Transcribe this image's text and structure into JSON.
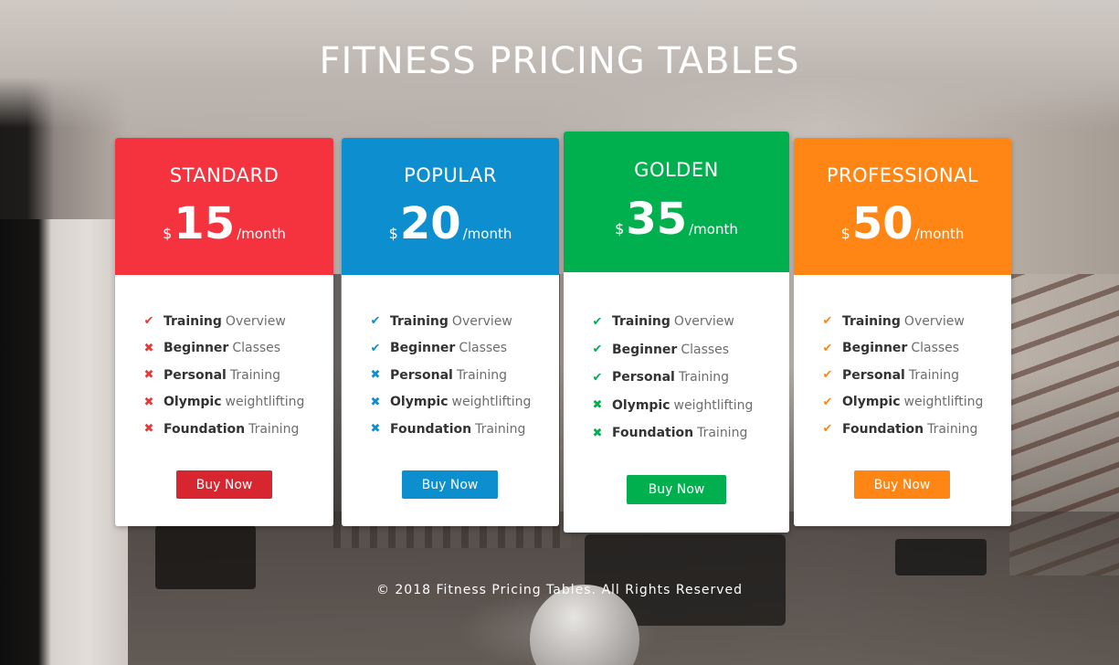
{
  "page": {
    "title": "FITNESS PRICING TABLES",
    "footer": "© 2018 Fitness Pricing Tables. All Rights Reserved"
  },
  "colors": {
    "standard": "#f5333f",
    "popular": "#0d8ece",
    "golden": "#00b04f",
    "professional": "#ff8514",
    "standard_button": "#d7262f",
    "cross": "#e53935"
  },
  "plans": [
    {
      "name": "STANDARD",
      "currency": "$",
      "amount": "15",
      "period": "/month",
      "button": "Buy Now",
      "features": [
        {
          "strong": "Training",
          "light": "Overview",
          "icon": "check-icon"
        },
        {
          "strong": "Beginner",
          "light": "Classes",
          "icon": "cross-icon"
        },
        {
          "strong": "Personal",
          "light": "Training",
          "icon": "cross-icon"
        },
        {
          "strong": "Olympic",
          "light": "weightlifting",
          "icon": "cross-icon"
        },
        {
          "strong": "Foundation",
          "light": "Training",
          "icon": "cross-icon"
        }
      ]
    },
    {
      "name": "POPULAR",
      "currency": "$",
      "amount": "20",
      "period": "/month",
      "button": "Buy Now",
      "features": [
        {
          "strong": "Training",
          "light": "Overview",
          "icon": "check-icon"
        },
        {
          "strong": "Beginner",
          "light": "Classes",
          "icon": "check-icon"
        },
        {
          "strong": "Personal",
          "light": "Training",
          "icon": "cross-icon"
        },
        {
          "strong": "Olympic",
          "light": "weightlifting",
          "icon": "cross-icon"
        },
        {
          "strong": "Foundation",
          "light": "Training",
          "icon": "cross-icon"
        }
      ]
    },
    {
      "name": "GOLDEN",
      "currency": "$",
      "amount": "35",
      "period": "/month",
      "button": "Buy Now",
      "features": [
        {
          "strong": "Training",
          "light": "Overview",
          "icon": "check-icon"
        },
        {
          "strong": "Beginner",
          "light": "Classes",
          "icon": "check-icon"
        },
        {
          "strong": "Personal",
          "light": "Training",
          "icon": "check-icon"
        },
        {
          "strong": "Olympic",
          "light": "weightlifting",
          "icon": "cross-icon"
        },
        {
          "strong": "Foundation",
          "light": "Training",
          "icon": "cross-icon"
        }
      ]
    },
    {
      "name": "PROFESSIONAL",
      "currency": "$",
      "amount": "50",
      "period": "/month",
      "button": "Buy Now",
      "features": [
        {
          "strong": "Training",
          "light": "Overview",
          "icon": "check-icon"
        },
        {
          "strong": "Beginner",
          "light": "Classes",
          "icon": "check-icon"
        },
        {
          "strong": "Personal",
          "light": "Training",
          "icon": "check-icon"
        },
        {
          "strong": "Olympic",
          "light": "weightlifting",
          "icon": "check-icon"
        },
        {
          "strong": "Foundation",
          "light": "Training",
          "icon": "check-icon"
        }
      ]
    }
  ]
}
